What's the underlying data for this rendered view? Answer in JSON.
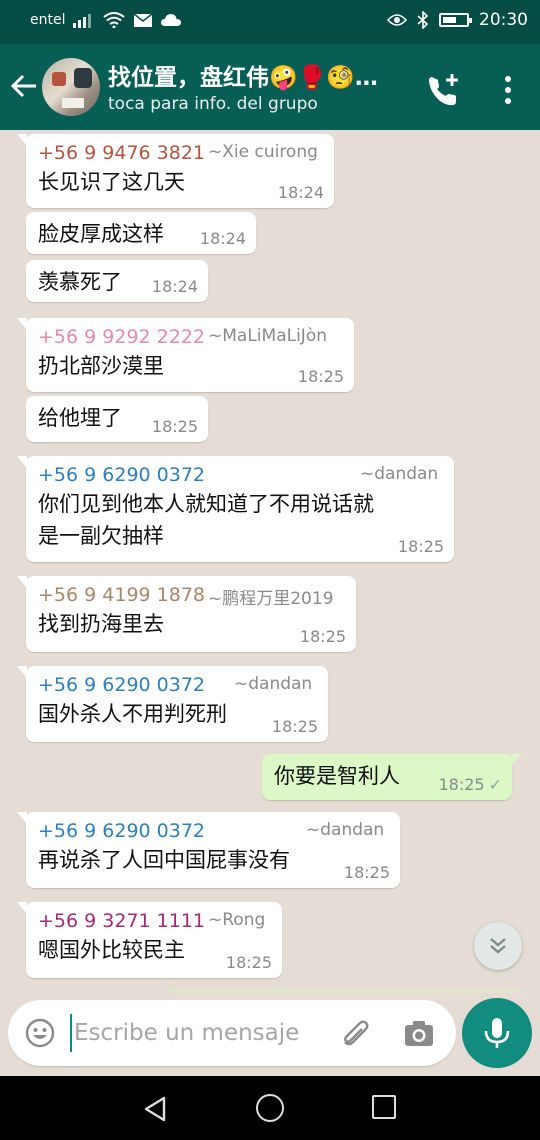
{
  "status_bar": {
    "carrier": "entel",
    "time": "20:30",
    "battery_level": 0.6
  },
  "header": {
    "title": "找位置，盘红伟🤪🥊🧐…",
    "subtitle": "toca para info. del grupo"
  },
  "colors": {
    "header": "#075e54",
    "status_bar": "#054d44",
    "incoming": "#ffffff",
    "outgoing": "#dcf8c6",
    "accent": "#128c7e",
    "chat_bg": "#e5ddd5"
  },
  "messages": [
    {
      "sender": "+56 9 9476 3821",
      "alias": "~Xie cuirong",
      "color": "#b5533e",
      "text": "长见识了这几天",
      "time": "18:24"
    },
    {
      "text": "脸皮厚成这样",
      "time": "18:24"
    },
    {
      "text": "羡慕死了",
      "time": "18:24"
    },
    {
      "sender": "+56 9 9292 2222",
      "alias": "~MaLiMaLiJòn",
      "color": "#e58aa8",
      "text": "扔北部沙漠里",
      "time": "18:25"
    },
    {
      "text": "给他埋了",
      "time": "18:25"
    },
    {
      "sender": "+56 9 6290 0372",
      "alias": "~dandan",
      "color": "#2c7fc0",
      "text_lines": [
        "你们见到他本人就知道了不用说话就",
        "是一副欠抽样"
      ],
      "time": "18:25"
    },
    {
      "sender": "+56 9 4199 1878",
      "alias": "~鹏程万里2019",
      "color": "#a9866c",
      "text": "找到扔海里去",
      "time": "18:25"
    },
    {
      "sender": "+56 9 6290 0372",
      "alias": "~dandan",
      "color": "#2c7fc0",
      "text": "国外杀人不用判死刑",
      "time": "18:25"
    },
    {
      "outgoing": true,
      "text": "你要是智利人",
      "time": "18:25"
    },
    {
      "sender": "+56 9 6290 0372",
      "alias": "~dandan",
      "color": "#2c7fc0",
      "text": "再说杀了人回中国屁事没有",
      "time": "18:25"
    },
    {
      "sender": "+56 9 3271 1111",
      "alias": "~Rong",
      "color": "#a52a78",
      "text": "嗯国外比较民主",
      "time": "18:25"
    }
  ],
  "composer": {
    "placeholder": "Escribe un mensaje"
  },
  "icons": [
    "back-arrow-icon",
    "add-call-icon",
    "more-vert-icon",
    "emoji-icon",
    "attach-icon",
    "camera-icon",
    "mic-icon",
    "scroll-down-icon"
  ]
}
